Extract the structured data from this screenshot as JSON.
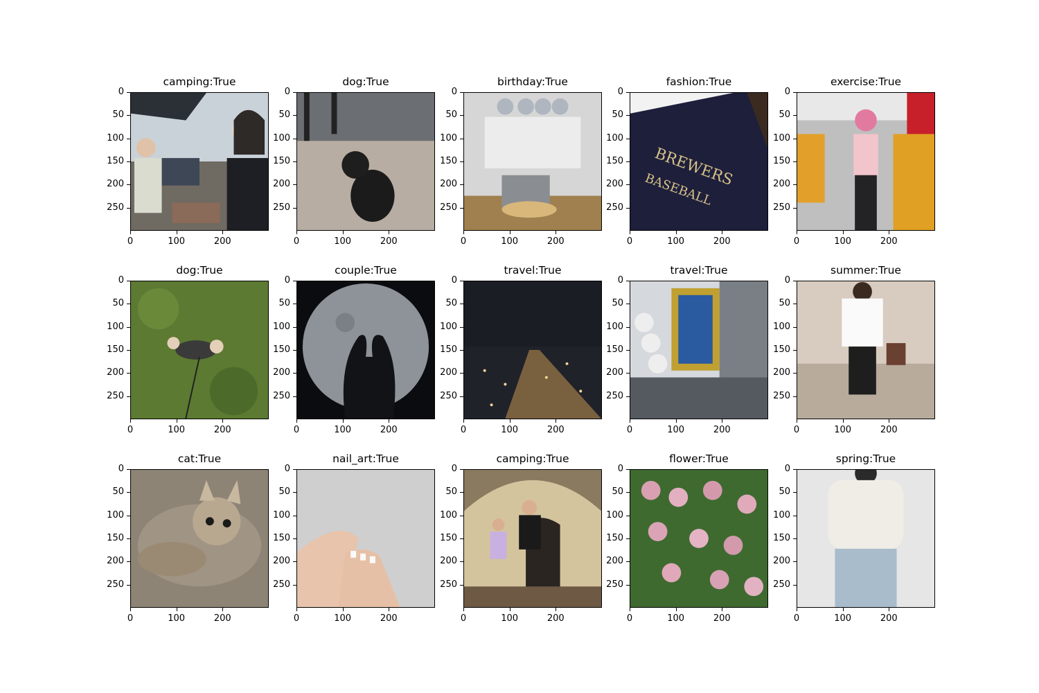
{
  "figure": {
    "panels": [
      {
        "title": "camping:True",
        "icon": "people-camping-photo"
      },
      {
        "title": "dog:True",
        "icon": "black-dog-photo"
      },
      {
        "title": "birthday:True",
        "icon": "birthday-decoration-photo"
      },
      {
        "title": "fashion:True",
        "icon": "brewers-tshirt-photo"
      },
      {
        "title": "exercise:True",
        "icon": "gym-selfie-photo"
      },
      {
        "title": "dog:True",
        "icon": "dog-on-grass-photo"
      },
      {
        "title": "couple:True",
        "icon": "moon-silhouette-photo"
      },
      {
        "title": "travel:True",
        "icon": "night-city-photo"
      },
      {
        "title": "travel:True",
        "icon": "city-billboards-photo"
      },
      {
        "title": "summer:True",
        "icon": "child-summer-outfit-photo"
      },
      {
        "title": "cat:True",
        "icon": "kitten-photo"
      },
      {
        "title": "nail_art:True",
        "icon": "nail-art-hands-photo"
      },
      {
        "title": "camping:True",
        "icon": "family-camping-tent-photo"
      },
      {
        "title": "flower:True",
        "icon": "pink-roses-photo"
      },
      {
        "title": "spring:True",
        "icon": "white-tshirt-outfit-photo"
      }
    ],
    "y_ticks": [
      "0",
      "50",
      "100",
      "150",
      "200",
      "250"
    ],
    "x_ticks": [
      "0",
      "100",
      "200"
    ],
    "colors": {
      "axis": "#000000",
      "background": "#ffffff"
    }
  }
}
